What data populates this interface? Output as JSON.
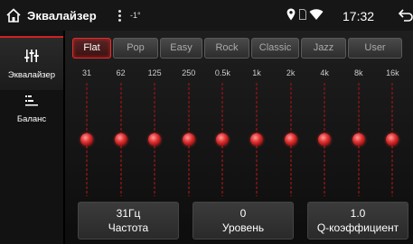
{
  "status_bar": {
    "title": "Эквалайзер",
    "temperature": "-1°",
    "time": "17:32"
  },
  "sidebar": {
    "items": [
      {
        "label": "Эквалайзер",
        "icon": "equalizer-sliders-icon",
        "active": true
      },
      {
        "label": "Баланс",
        "icon": "balance-icon",
        "active": false
      }
    ]
  },
  "presets": [
    {
      "label": "Flat",
      "active": true
    },
    {
      "label": "Pop",
      "active": false
    },
    {
      "label": "Easy",
      "active": false
    },
    {
      "label": "Rock",
      "active": false
    },
    {
      "label": "Classic",
      "active": false
    },
    {
      "label": "Jazz",
      "active": false
    },
    {
      "label": "User",
      "active": false
    }
  ],
  "bands": [
    {
      "freq": "31",
      "level": 0
    },
    {
      "freq": "62",
      "level": 0
    },
    {
      "freq": "125",
      "level": 0
    },
    {
      "freq": "250",
      "level": 0
    },
    {
      "freq": "0.5k",
      "level": 0
    },
    {
      "freq": "1k",
      "level": 0
    },
    {
      "freq": "2k",
      "level": 0
    },
    {
      "freq": "4k",
      "level": 0
    },
    {
      "freq": "8k",
      "level": 0
    },
    {
      "freq": "16k",
      "level": 0
    }
  ],
  "readouts": {
    "frequency": {
      "value": "31Гц",
      "caption": "Частота"
    },
    "level": {
      "value": "0",
      "caption": "Уровень"
    },
    "q_factor": {
      "value": "1.0",
      "caption": "Q-коэффициент"
    }
  },
  "colors": {
    "accent": "#d83030",
    "background": "#000000"
  }
}
